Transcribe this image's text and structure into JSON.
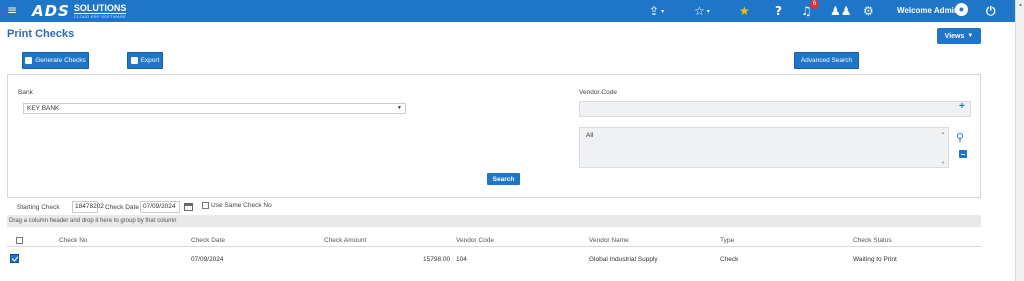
{
  "header": {
    "logo_mark": "ADS",
    "logo_name": "SOLUTIONS",
    "logo_tagline": "CLOUD ERP SOFTWARE",
    "notification_count": "6",
    "welcome_text": "Welcome Admin",
    "icons": [
      "menu-icon",
      "share-icon",
      "star-outline-icon",
      "star-gold-icon",
      "help-icon",
      "bell-icon",
      "users-icon",
      "gear-icon",
      "user-icon",
      "power-icon"
    ],
    "bar_color": "#1f75c8"
  },
  "page": {
    "title": "Print Checks",
    "views_label": "Views"
  },
  "toolbar": {
    "generate_label": "Generate Checks",
    "export_label": "Export",
    "advanced_search_label": "Advanced Search"
  },
  "search": {
    "bank_label": "Bank",
    "bank_value": "KEY BANK",
    "vendor_code_label": "Vendor Code",
    "vendor_code_value": "",
    "vendor_list_value": "All",
    "search_label": "Search"
  },
  "options": {
    "starting_check_label": "Starting Check",
    "starting_check_value": "18478202",
    "check_date_label": "Check Date",
    "check_date_value": "07/09/2024",
    "use_same_check_label": "Use Same Check No",
    "use_same_check_checked": false
  },
  "grid": {
    "group_hint": "Drag a column header and drop it here to group by that column",
    "columns": [
      "Check No",
      "Check Date",
      "Check Amount",
      "Vendor Code",
      "Vendor Name",
      "Type",
      "Check Status"
    ],
    "rows": [
      {
        "selected": true,
        "check_no": "",
        "check_date": "07/09/2024",
        "check_amount": "15798.00",
        "vendor_code": "104",
        "vendor_name": "Global Industrial Supply",
        "type": "Check",
        "check_status": "Waiting to Print"
      }
    ]
  }
}
